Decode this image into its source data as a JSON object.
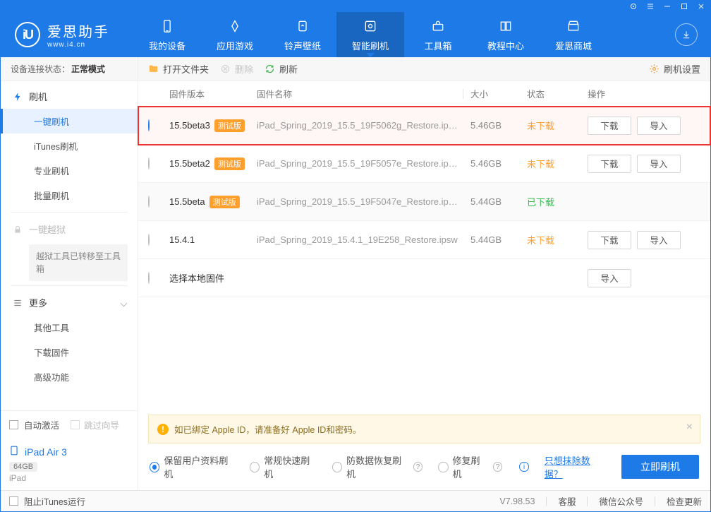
{
  "titlebar_icons": [
    "settings",
    "menu",
    "min",
    "max",
    "close"
  ],
  "brand": {
    "name": "爱思助手",
    "url": "www.i4.cn",
    "mark": "iU"
  },
  "navs": [
    {
      "label": "我的设备"
    },
    {
      "label": "应用游戏"
    },
    {
      "label": "铃声壁纸"
    },
    {
      "label": "智能刷机",
      "active": true
    },
    {
      "label": "工具箱"
    },
    {
      "label": "教程中心"
    },
    {
      "label": "爱思商城"
    }
  ],
  "conn": {
    "label": "设备连接状态：",
    "value": "正常模式"
  },
  "sidebar": {
    "flash_head": "刷机",
    "flash_items": [
      "一键刷机",
      "iTunes刷机",
      "专业刷机",
      "批量刷机"
    ],
    "jailbreak_head": "一键越狱",
    "jailbreak_note": "越狱工具已转移至工具箱",
    "more_head": "更多",
    "more_items": [
      "其他工具",
      "下载固件",
      "高级功能"
    ]
  },
  "autoact": {
    "label": "自动激活",
    "skip": "跳过向导"
  },
  "device": {
    "name": "iPad Air 3",
    "capacity": "64GB",
    "type": "iPad"
  },
  "toolbar": {
    "open": "打开文件夹",
    "delete": "删除",
    "refresh": "刷新",
    "settings": "刷机设置"
  },
  "thead": {
    "ver": "固件版本",
    "name": "固件名称",
    "size": "大小",
    "status": "状态",
    "op": "操作"
  },
  "rows": [
    {
      "ver": "15.5beta3",
      "beta": "测试版",
      "name": "iPad_Spring_2019_15.5_19F5062g_Restore.ip…",
      "size": "5.46GB",
      "status": "未下载",
      "status_ok": false,
      "selected": true,
      "hl": true,
      "download": "下载",
      "import": "导入"
    },
    {
      "ver": "15.5beta2",
      "beta": "测试版",
      "name": "iPad_Spring_2019_15.5_19F5057e_Restore.ip…",
      "size": "5.46GB",
      "status": "未下载",
      "status_ok": false,
      "download": "下载",
      "import": "导入"
    },
    {
      "ver": "15.5beta",
      "beta": "测试版",
      "name": "iPad_Spring_2019_15.5_19F5047e_Restore.ip…",
      "size": "5.44GB",
      "status": "已下载",
      "status_ok": true,
      "alt": true
    },
    {
      "ver": "15.4.1",
      "name": "iPad_Spring_2019_15.4.1_19E258_Restore.ipsw",
      "size": "5.44GB",
      "status": "未下载",
      "status_ok": false,
      "download": "下载",
      "import": "导入"
    },
    {
      "ver": "选择本地固件",
      "local": true,
      "import": "导入"
    }
  ],
  "alert": {
    "text": "如已绑定 Apple ID，请准备好 Apple ID和密码。"
  },
  "opts": {
    "a": "保留用户资料刷机",
    "b": "常规快速刷机",
    "c": "防数据恢复刷机",
    "d": "修复刷机",
    "link": "只想抹除数据？",
    "primary": "立即刷机"
  },
  "status": {
    "block": "阻止iTunes运行",
    "ver": "V7.98.53",
    "cs": "客服",
    "wx": "微信公众号",
    "upd": "检查更新"
  }
}
